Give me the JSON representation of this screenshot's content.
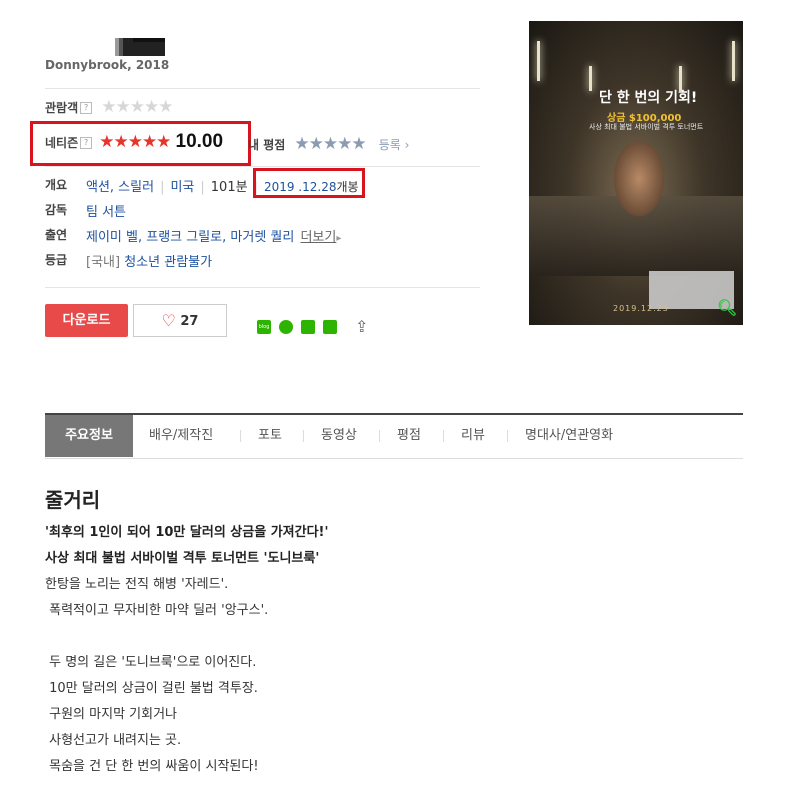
{
  "movie": {
    "title_en": "Donnybrook, 2018"
  },
  "ratings": {
    "audience_label": "관람객",
    "audience_stars": "★★★★★",
    "netizen_label": "네티즌",
    "netizen_stars": "★★★★★",
    "netizen_score": "10.00",
    "my_rating_label": "내 평점",
    "my_rating_stars": "★★★★★",
    "register_label": "등록",
    "help_glyph": "?"
  },
  "info": {
    "overview_label": "개요",
    "genres": "액션, 스릴러",
    "country": "미국",
    "runtime": "101분",
    "release_date": "2019 .12.28",
    "release_suffix": "개봉",
    "director_label": "감독",
    "director": "팀 서튼",
    "cast_label": "출연",
    "cast": "제이미 벨, 프랭크 그릴로, 마거렛 퀄리",
    "more_label": "더보기",
    "grade_label": "등급",
    "grade_region": "[국내]",
    "grade": "청소년 관람불가"
  },
  "actions": {
    "download_label": "다운로드",
    "like_icon": "heart-outline",
    "like_count": "27",
    "share_icons": [
      "blog-icon",
      "talk-icon",
      "bookmark-icon",
      "band-icon",
      "share-icon"
    ],
    "blog_text": "blog"
  },
  "poster": {
    "headline": "단 한 번의 기회!",
    "prize": "상금 $100,000",
    "tagline": "사상 최대 불법 서바이벌 격투 토너먼트",
    "date": "2019.12.23",
    "zoom_icon": "magnifier-icon"
  },
  "tabs": [
    {
      "label": "주요정보",
      "active": true
    },
    {
      "label": "배우/제작진",
      "active": false
    },
    {
      "label": "포토",
      "active": false
    },
    {
      "label": "동영상",
      "active": false
    },
    {
      "label": "평점",
      "active": false
    },
    {
      "label": "리뷰",
      "active": false
    },
    {
      "label": "명대사/연관영화",
      "active": false
    }
  ],
  "synopsis": {
    "heading": "줄거리",
    "lines": [
      "'최후의 1인이 되어 10만 달러의 상금을 가져간다!'",
      "사상 최대 불법 서바이벌 격투 토너먼트 '도니브룩'",
      "한탕을 노리는 전직 해병 '자레드'.",
      " 폭력적이고 무자비한 마약 딜러 '앙구스'.",
      "",
      " 두 명의 길은 '도니브룩'으로 이어진다.",
      " 10만 달러의 상금이 걸린 불법 격투장.",
      " 구원의 마지막 기회거나",
      " 사형선고가 내려지는 곳.",
      " 목숨을 건 단 한 번의 싸움이 시작된다!"
    ]
  },
  "colors": {
    "accent_red": "#e8352a",
    "link_blue": "#1e52a0",
    "download_bg": "#e84a4a",
    "highlight_box": "#d9141e"
  }
}
